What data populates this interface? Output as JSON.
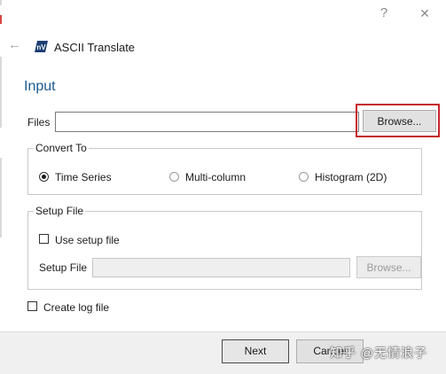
{
  "app": {
    "title": "ASCII Translate",
    "logo_text": "nV"
  },
  "titlebar": {
    "help_icon": "?",
    "close_icon": "✕"
  },
  "input_section": {
    "title": "Input",
    "files_label": "Files",
    "files_value": "",
    "browse_label": "Browse..."
  },
  "convert_to": {
    "title": "Convert To",
    "options": [
      {
        "label": "Time Series",
        "selected": true
      },
      {
        "label": "Multi-column",
        "selected": false
      },
      {
        "label": "Histogram (2D)",
        "selected": false
      }
    ]
  },
  "setup_file": {
    "title": "Setup File",
    "use_setup_label": "Use setup file",
    "use_setup_checked": false,
    "setup_file_label": "Setup File",
    "setup_file_value": "",
    "browse_label": "Browse...",
    "browse_enabled": false
  },
  "options": {
    "create_log_label": "Create log file",
    "create_log_checked": false
  },
  "footer": {
    "next_label": "Next",
    "cancel_label": "Cancel"
  },
  "watermark": {
    "text": "知乎 @无情浪子"
  },
  "colors": {
    "accent": "#1a5a93",
    "highlight_border": "#c8232c",
    "footer_bg": "#f0f0f0"
  }
}
